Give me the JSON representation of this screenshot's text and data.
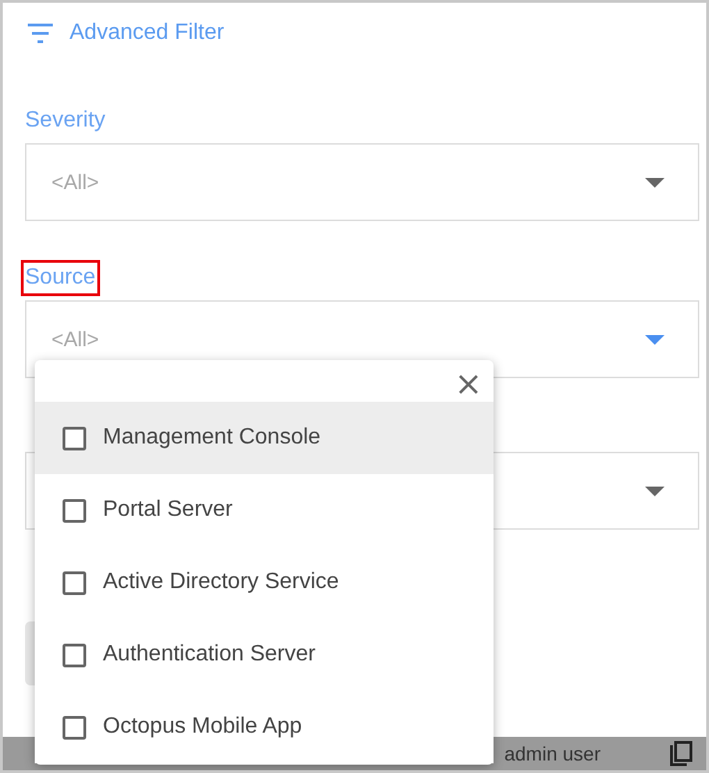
{
  "header": {
    "title": "Advanced Filter"
  },
  "fields": [
    {
      "label": "Severity",
      "value": "<All>",
      "open": false,
      "highlighted": false
    },
    {
      "label": "Source",
      "value": "<All>",
      "open": true,
      "highlighted": true
    },
    {
      "open": false,
      "highlighted": false
    }
  ],
  "dropdown": {
    "close": "×",
    "options": [
      {
        "label": "Management Console",
        "checked": false,
        "hovered": true
      },
      {
        "label": "Portal Server",
        "checked": false,
        "hovered": false
      },
      {
        "label": "Active Directory Service",
        "checked": false,
        "hovered": false
      },
      {
        "label": "Authentication Server",
        "checked": false,
        "hovered": false
      },
      {
        "label": "Octopus Mobile App",
        "checked": false,
        "hovered": false
      }
    ]
  },
  "status_bar": {
    "user": "admin user"
  }
}
